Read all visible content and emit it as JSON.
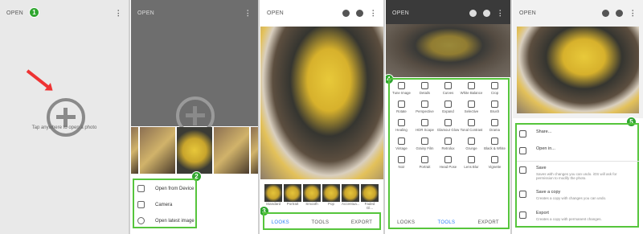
{
  "panel1": {
    "title": "OPEN",
    "badge": "1",
    "tap_text": "Tap anywhere to open a photo"
  },
  "panel2": {
    "title": "OPEN",
    "badge": "2",
    "menu": [
      "Open from Device",
      "Camera",
      "Open latest image"
    ]
  },
  "panel3": {
    "title": "OPEN",
    "badge": "3",
    "looks": [
      "Standard",
      "Portrait",
      "Smooth",
      "Pop",
      "Accentua...",
      "Faded Gl..."
    ],
    "tabs": [
      "LOOKS",
      "TOOLS",
      "EXPORT"
    ]
  },
  "panel4": {
    "title": "OPEN",
    "badge": "4",
    "tools": [
      "Tune Image",
      "Details",
      "Curves",
      "White Balance",
      "Crop",
      "Rotate",
      "Perspective",
      "Expand",
      "Selective",
      "Brush",
      "Healing",
      "HDR Scape",
      "Glamour Glow",
      "Tonal Contrast",
      "Drama",
      "Vintage",
      "Grainy Film",
      "Retrolux",
      "Grunge",
      "Black & White",
      "Noir",
      "Portrait",
      "Head Pose",
      "Lens Blur",
      "Vignette"
    ],
    "tabs": [
      "LOOKS",
      "TOOLS",
      "EXPORT"
    ]
  },
  "panel5": {
    "title": "OPEN",
    "badge": "5",
    "items": [
      {
        "title": "Share...",
        "desc": ""
      },
      {
        "title": "Open in...",
        "desc": ""
      },
      {
        "title": "Save",
        "desc": "Saves with changes you can undo. iOS will ask for permission to modify the photo."
      },
      {
        "title": "Save a copy",
        "desc": "Creates a copy with changes you can undo."
      },
      {
        "title": "Export",
        "desc": "Creates a copy with permanent changes."
      }
    ]
  },
  "colors": {
    "badge": "#2fa62f",
    "highlight": "#56c53c",
    "active_tab": "#2a7ff5",
    "arrow": "#e33333"
  }
}
